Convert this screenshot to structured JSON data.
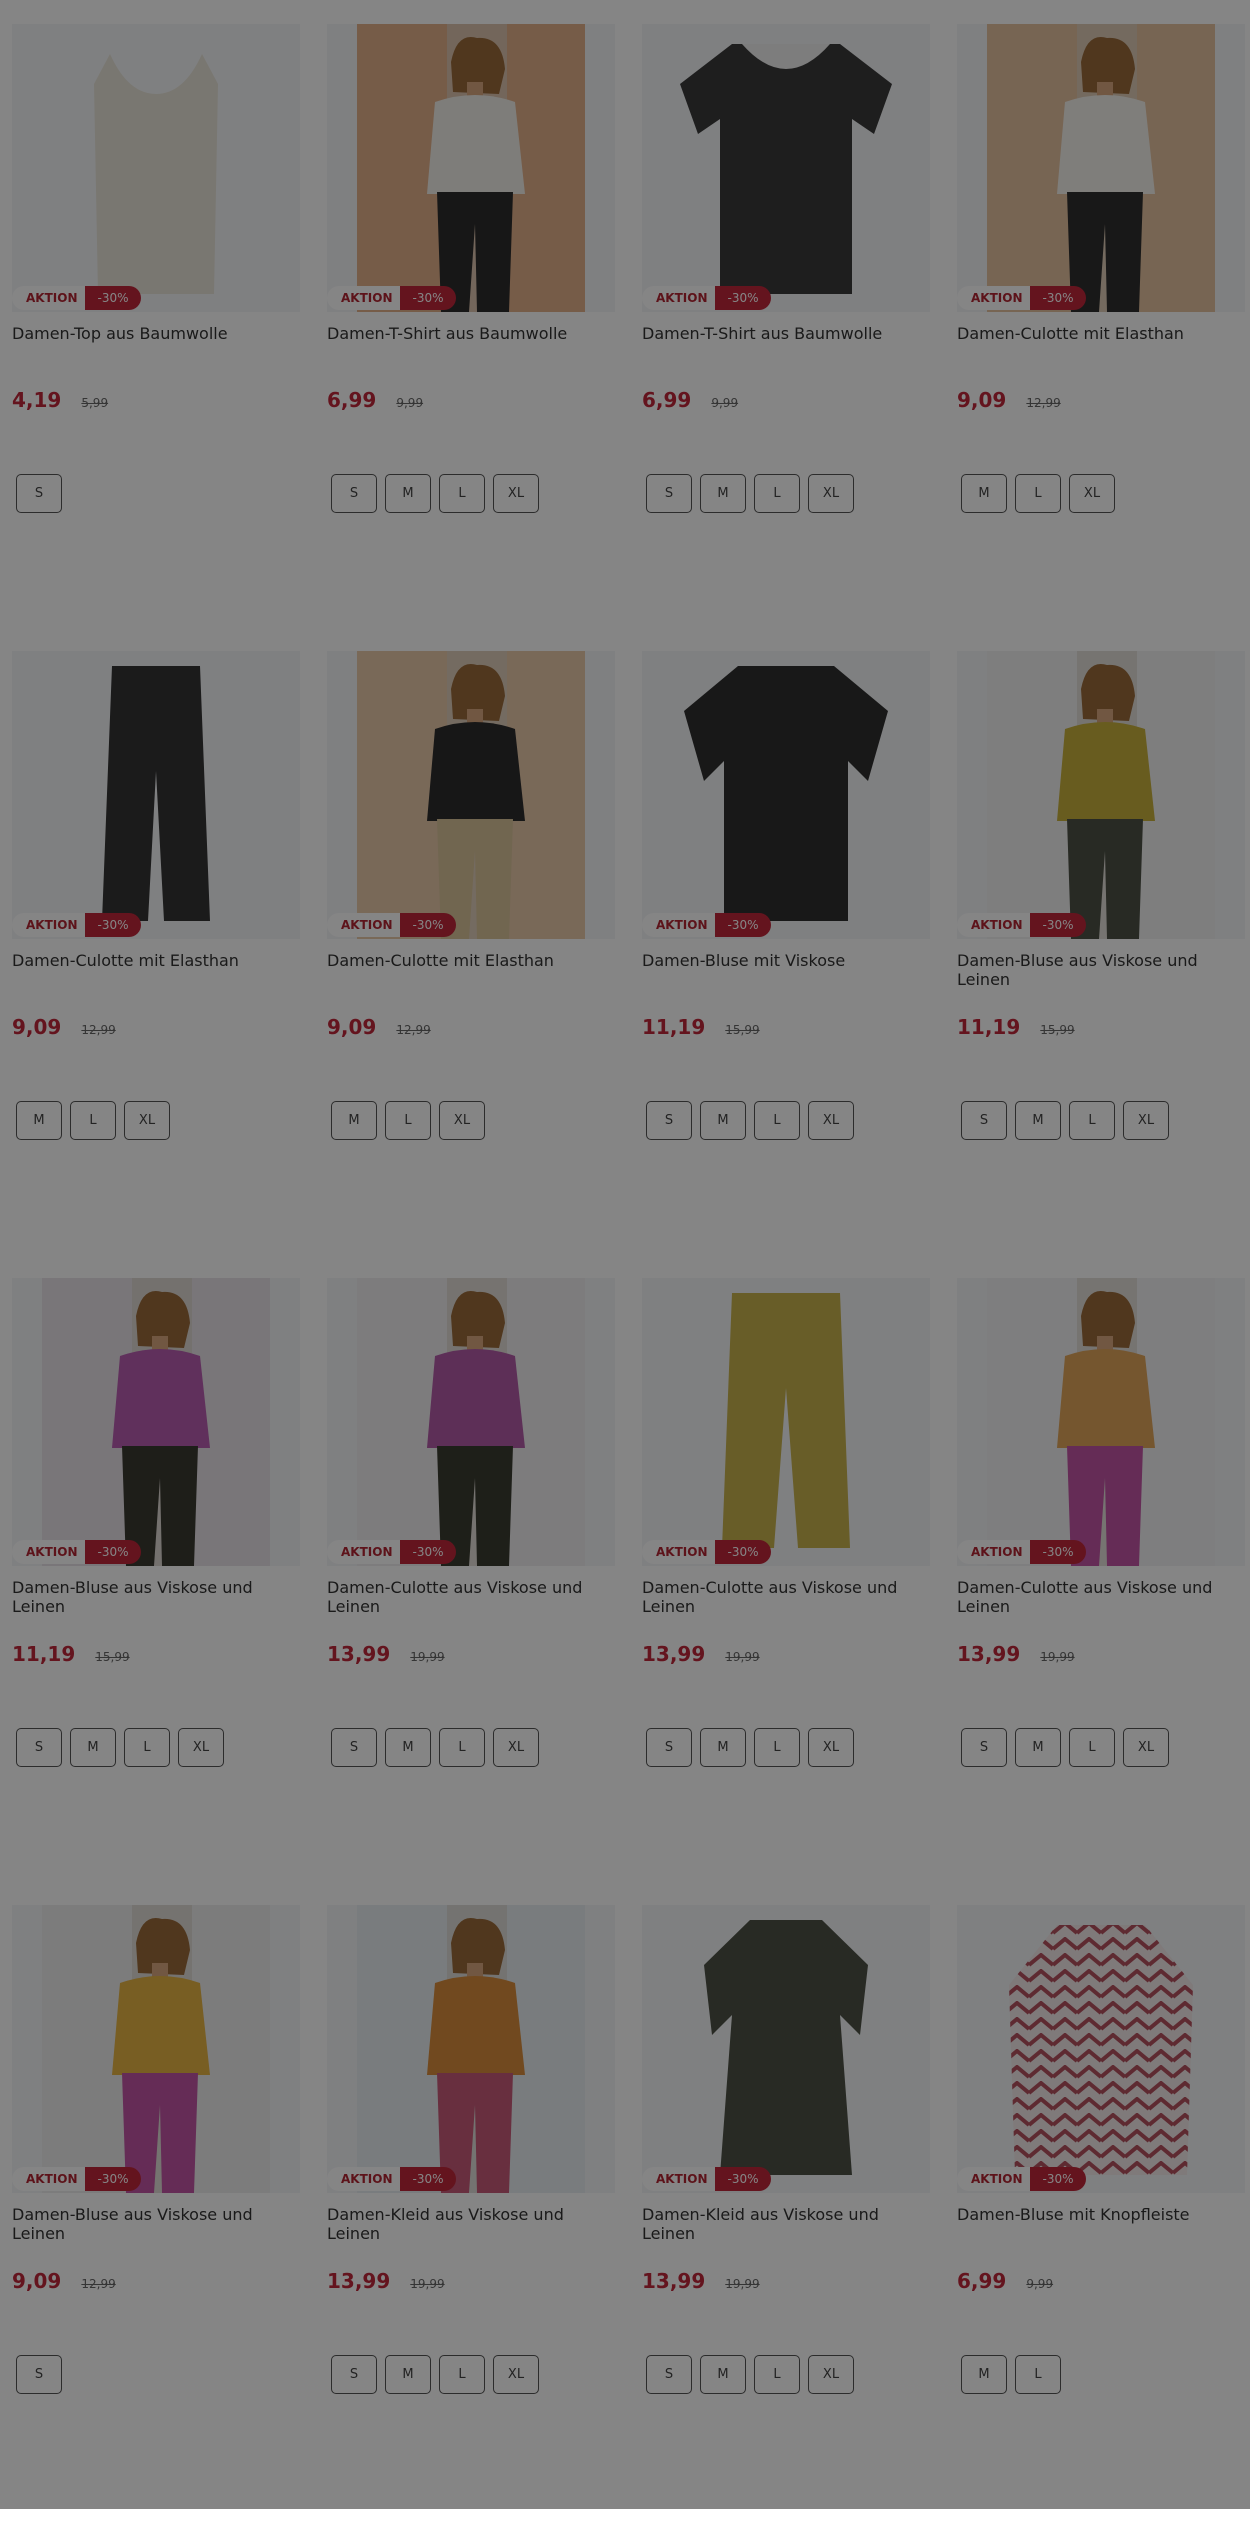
{
  "badges": {
    "aktion": "AKTION"
  },
  "products": [
    {
      "name": "Damen-Top aus Baumwolle",
      "price": "4,19",
      "old_price": "5,99",
      "discount": "-30%",
      "sizes": [
        "S"
      ],
      "image": "top-cream"
    },
    {
      "name": "Damen-T-Shirt aus Baumwolle",
      "price": "6,99",
      "old_price": "9,99",
      "discount": "-30%",
      "sizes": [
        "S",
        "M",
        "L",
        "XL"
      ],
      "image": "model-white-tee"
    },
    {
      "name": "Damen-T-Shirt aus Baumwolle",
      "price": "6,99",
      "old_price": "9,99",
      "discount": "-30%",
      "sizes": [
        "S",
        "M",
        "L",
        "XL"
      ],
      "image": "tee-black-lace"
    },
    {
      "name": "Damen-Culotte mit Elasthan",
      "price": "9,09",
      "old_price": "12,99",
      "discount": "-30%",
      "sizes": [
        "M",
        "L",
        "XL"
      ],
      "image": "model-striped-culotte"
    },
    {
      "name": "Damen-Culotte mit Elasthan",
      "price": "9,09",
      "old_price": "12,99",
      "discount": "-30%",
      "sizes": [
        "M",
        "L",
        "XL"
      ],
      "image": "culotte-black"
    },
    {
      "name": "Damen-Culotte mit Elasthan",
      "price": "9,09",
      "old_price": "12,99",
      "discount": "-30%",
      "sizes": [
        "M",
        "L",
        "XL"
      ],
      "image": "model-beige-culotte"
    },
    {
      "name": "Damen-Bluse mit Viskose",
      "price": "11,19",
      "old_price": "15,99",
      "discount": "-30%",
      "sizes": [
        "S",
        "M",
        "L",
        "XL"
      ],
      "image": "blouse-black"
    },
    {
      "name": "Damen-Bluse aus Viskose und Leinen",
      "price": "11,19",
      "old_price": "15,99",
      "discount": "-30%",
      "sizes": [
        "S",
        "M",
        "L",
        "XL"
      ],
      "image": "model-mustard-blouse"
    },
    {
      "name": "Damen-Bluse aus Viskose und Leinen",
      "price": "11,19",
      "old_price": "15,99",
      "discount": "-30%",
      "sizes": [
        "S",
        "M",
        "L",
        "XL"
      ],
      "image": "model-purple-blouse"
    },
    {
      "name": "Damen-Culotte aus Viskose und Leinen",
      "price": "13,99",
      "old_price": "19,99",
      "discount": "-30%",
      "sizes": [
        "S",
        "M",
        "L",
        "XL"
      ],
      "image": "model-olive-culotte"
    },
    {
      "name": "Damen-Culotte aus Viskose und Leinen",
      "price": "13,99",
      "old_price": "19,99",
      "discount": "-30%",
      "sizes": [
        "S",
        "M",
        "L",
        "XL"
      ],
      "image": "culotte-mustard"
    },
    {
      "name": "Damen-Culotte aus Viskose und Leinen",
      "price": "13,99",
      "old_price": "19,99",
      "discount": "-30%",
      "sizes": [
        "S",
        "M",
        "L",
        "XL"
      ],
      "image": "model-pink-culotte"
    },
    {
      "name": "Damen-Bluse aus Viskose und Leinen",
      "price": "9,09",
      "old_price": "12,99",
      "discount": "-30%",
      "sizes": [
        "S"
      ],
      "image": "model-pattern-blouse"
    },
    {
      "name": "Damen-Kleid aus Viskose und Leinen",
      "price": "13,99",
      "old_price": "19,99",
      "discount": "-30%",
      "sizes": [
        "S",
        "M",
        "L",
        "XL"
      ],
      "image": "model-pattern-dress"
    },
    {
      "name": "Damen-Kleid aus Viskose und Leinen",
      "price": "13,99",
      "old_price": "19,99",
      "discount": "-30%",
      "sizes": [
        "S",
        "M",
        "L",
        "XL"
      ],
      "image": "dress-olive"
    },
    {
      "name": "Damen-Bluse mit Knopfleiste",
      "price": "6,99",
      "old_price": "9,99",
      "discount": "-30%",
      "sizes": [
        "M",
        "L"
      ],
      "image": "blouse-zigzag"
    }
  ],
  "colors": {
    "accent": "#c0273a",
    "overlay": "rgba(0,0,0,0.48)"
  }
}
